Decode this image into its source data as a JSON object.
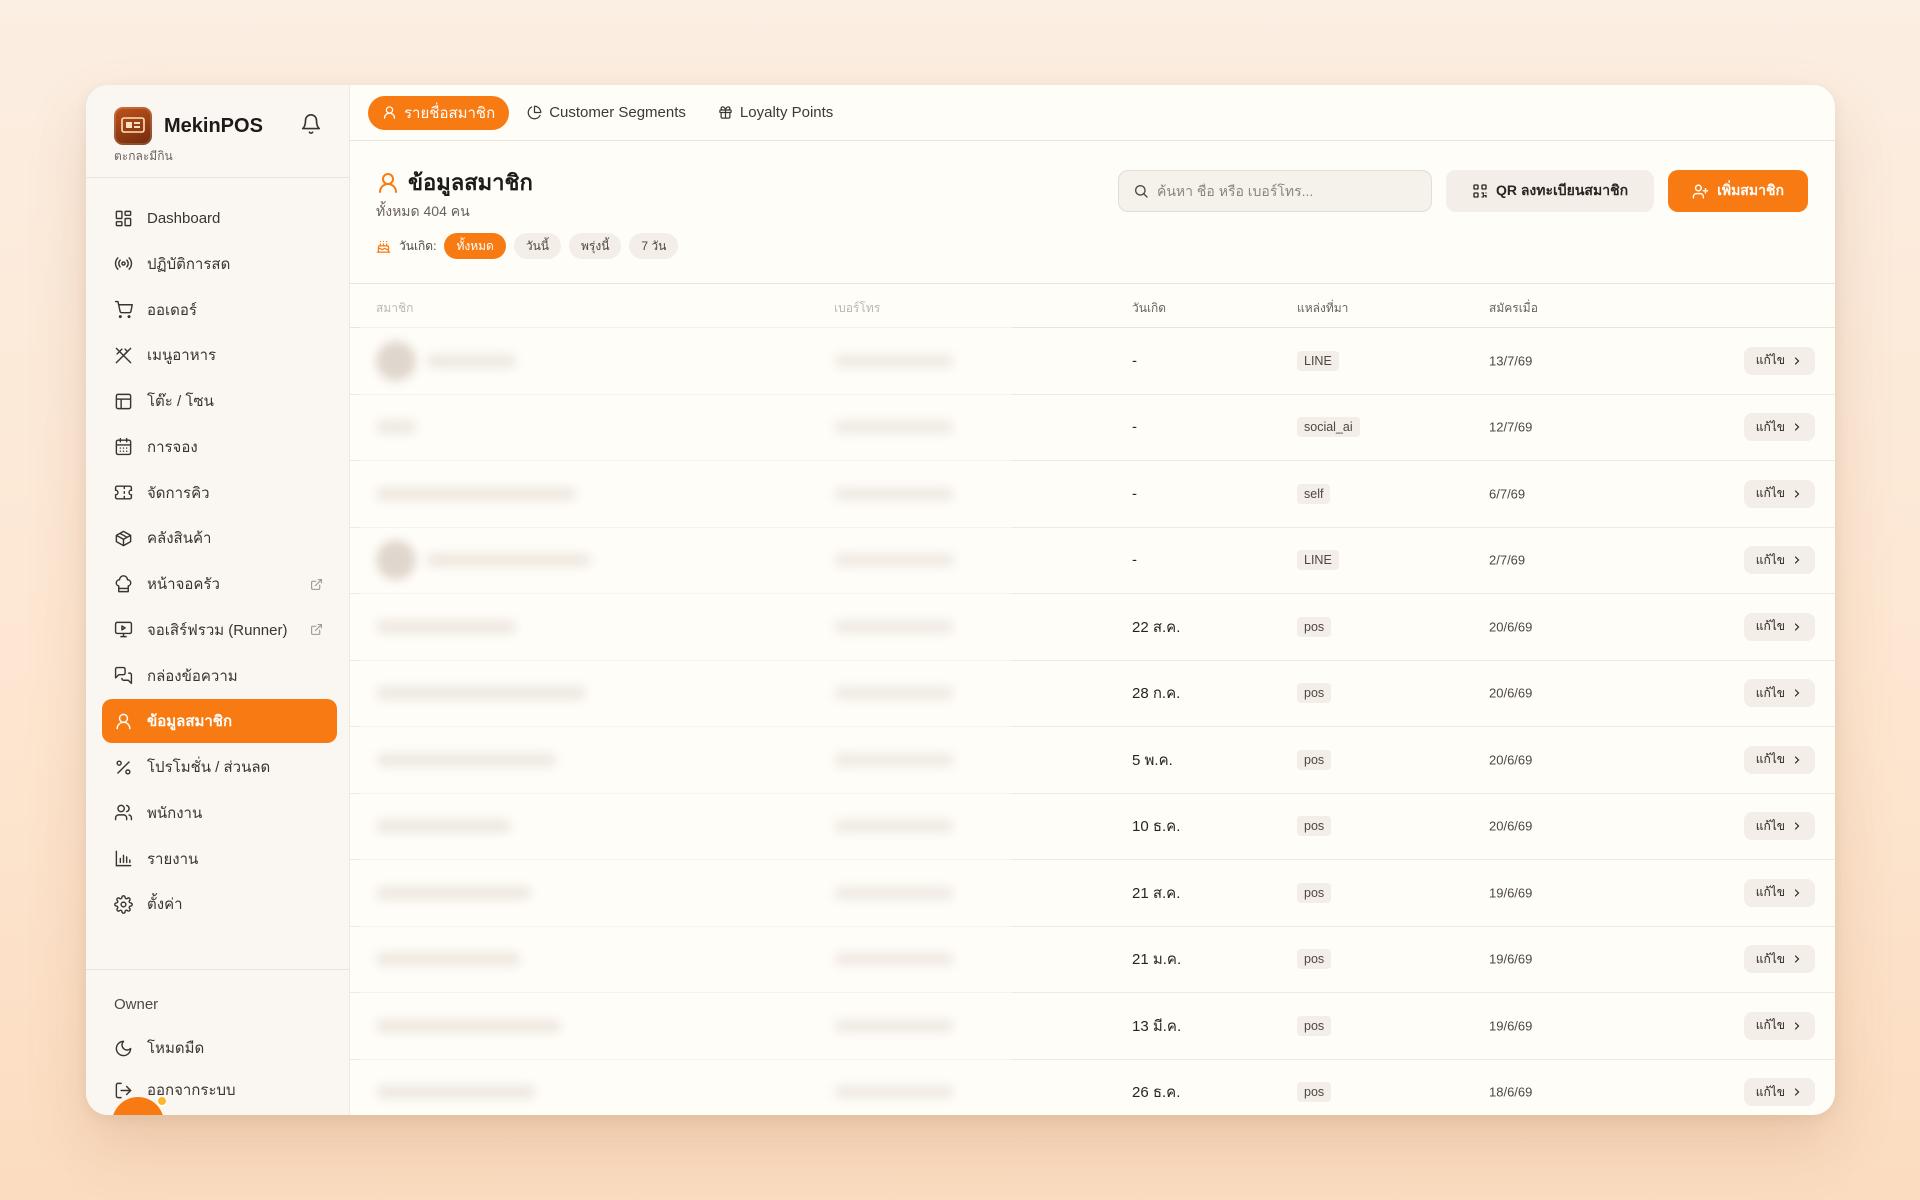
{
  "app": {
    "name": "MekinPOS",
    "subtitle": "ตะกละมีกิน",
    "logo_text": "mekin POS"
  },
  "colors": {
    "accent": "#f77b12",
    "background": "#fffdf8"
  },
  "sidebar": {
    "items": [
      {
        "label": "Dashboard",
        "icon": "dashboard-icon"
      },
      {
        "label": "ปฏิบัติการสด",
        "icon": "broadcast-icon"
      },
      {
        "label": "ออเดอร์",
        "icon": "cart-icon"
      },
      {
        "label": "เมนูอาหาร",
        "icon": "utensils-icon"
      },
      {
        "label": "โต๊ะ / โซน",
        "icon": "table-icon"
      },
      {
        "label": "การจอง",
        "icon": "calendar-icon"
      },
      {
        "label": "จัดการคิว",
        "icon": "ticket-icon"
      },
      {
        "label": "คลังสินค้า",
        "icon": "package-icon"
      },
      {
        "label": "หน้าจอครัว",
        "icon": "chef-hat-icon",
        "external": true
      },
      {
        "label": "จอเสิร์ฟรวม (Runner)",
        "icon": "monitor-play-icon",
        "external": true
      },
      {
        "label": "กล่องข้อความ",
        "icon": "messages-icon"
      },
      {
        "label": "ข้อมูลสมาชิก",
        "icon": "user-icon",
        "active": true
      },
      {
        "label": "โปรโมชั่น / ส่วนลด",
        "icon": "percent-icon"
      },
      {
        "label": "พนักงาน",
        "icon": "users-icon"
      },
      {
        "label": "รายงาน",
        "icon": "bar-chart-icon"
      },
      {
        "label": "ตั้งค่า",
        "icon": "gear-icon"
      }
    ],
    "role": "Owner",
    "dark_mode": "โหมดมืด",
    "logout": "ออกจากระบบ"
  },
  "tabs": [
    {
      "label": "รายชื่อสมาชิก",
      "icon": "user-icon",
      "active": true
    },
    {
      "label": "Customer Segments",
      "icon": "pie-chart-icon"
    },
    {
      "label": "Loyalty Points",
      "icon": "gift-icon"
    }
  ],
  "header": {
    "title": "ข้อมูลสมาชิก",
    "count": "ทั้งหมด 404 คน",
    "birthday_label": "วันเกิด:",
    "filters": [
      {
        "label": "ทั้งหมด",
        "active": true
      },
      {
        "label": "วันนี้"
      },
      {
        "label": "พรุ่งนี้"
      },
      {
        "label": "7 วัน"
      }
    ],
    "search_placeholder": "ค้นหา ชื่อ หรือ เบอร์โทร...",
    "qr_button": "QR ลงทะเบียนสมาชิก",
    "add_button": "เพิ่มสมาชิก"
  },
  "table": {
    "columns": [
      "สมาชิก",
      "เบอร์โทร",
      "วันเกิด",
      "แหล่งที่มา",
      "สมัครเมื่อ"
    ],
    "edit_label": "แก้ไข",
    "rows": [
      {
        "birthday": "-",
        "source": "LINE",
        "joined": "13/7/69"
      },
      {
        "birthday": "-",
        "source": "social_ai",
        "joined": "12/7/69"
      },
      {
        "birthday": "-",
        "source": "self",
        "joined": "6/7/69"
      },
      {
        "birthday": "-",
        "source": "LINE",
        "joined": "2/7/69"
      },
      {
        "birthday": "22 ส.ค.",
        "source": "pos",
        "joined": "20/6/69"
      },
      {
        "birthday": "28 ก.ค.",
        "source": "pos",
        "joined": "20/6/69"
      },
      {
        "birthday": "5 พ.ค.",
        "source": "pos",
        "joined": "20/6/69"
      },
      {
        "birthday": "10 ธ.ค.",
        "source": "pos",
        "joined": "20/6/69"
      },
      {
        "birthday": "21 ส.ค.",
        "source": "pos",
        "joined": "19/6/69"
      },
      {
        "birthday": "21 ม.ค.",
        "source": "pos",
        "joined": "19/6/69"
      },
      {
        "birthday": "13 มี.ค.",
        "source": "pos",
        "joined": "19/6/69"
      },
      {
        "birthday": "26 ธ.ค.",
        "source": "pos",
        "joined": "18/6/69"
      }
    ]
  }
}
